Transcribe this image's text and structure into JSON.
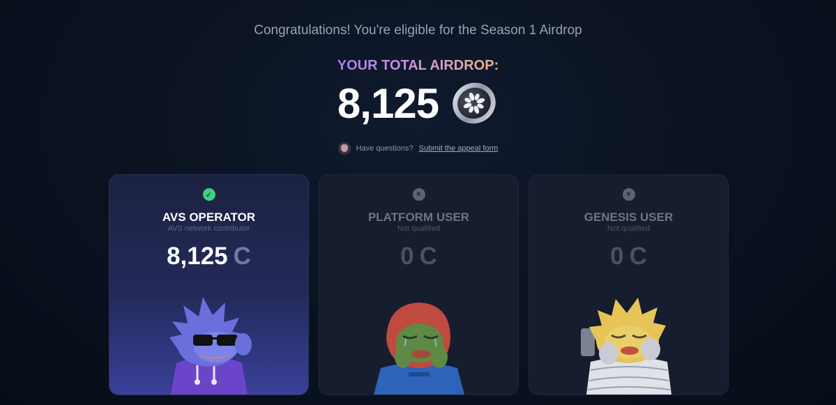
{
  "header": {
    "congrats_text": "Congratulations! You're eligible for the Season 1 Airdrop",
    "total_label": "YOUR TOTAL AIRDROP:",
    "total_amount": "8,125",
    "coin_icon": "token-coin-icon"
  },
  "help": {
    "question_text": "Have questions?",
    "appeal_link_text": "Submit the appeal form",
    "avatar_icon": "support-avatar-icon"
  },
  "cards": [
    {
      "title": "AVS OPERATOR",
      "subtitle": "AVS network contributor",
      "amount": "8,125",
      "currency": "C",
      "status": "qualified",
      "status_icon": "check-icon",
      "status_glyph": "✓",
      "mascot": "sunglasses-mascot-purple-hoodie"
    },
    {
      "title": "PLATFORM USER",
      "subtitle": "Not qualified",
      "amount": "0",
      "currency": "C",
      "status": "not-qualified",
      "status_icon": "x-icon",
      "status_glyph": "×",
      "mascot": "crying-mascot-blue-shirt"
    },
    {
      "title": "GENESIS USER",
      "subtitle": "Not qualified",
      "amount": "0",
      "currency": "C",
      "status": "not-qualified",
      "status_icon": "x-icon",
      "status_glyph": "×",
      "mascot": "crying-mascot-spacesuit"
    }
  ],
  "colors": {
    "background": "#0b1322",
    "qualified": "#3fcf7f",
    "not_qualified": "#5c6373",
    "gradient_start": "#a77cf0",
    "gradient_end": "#f3b27e"
  }
}
